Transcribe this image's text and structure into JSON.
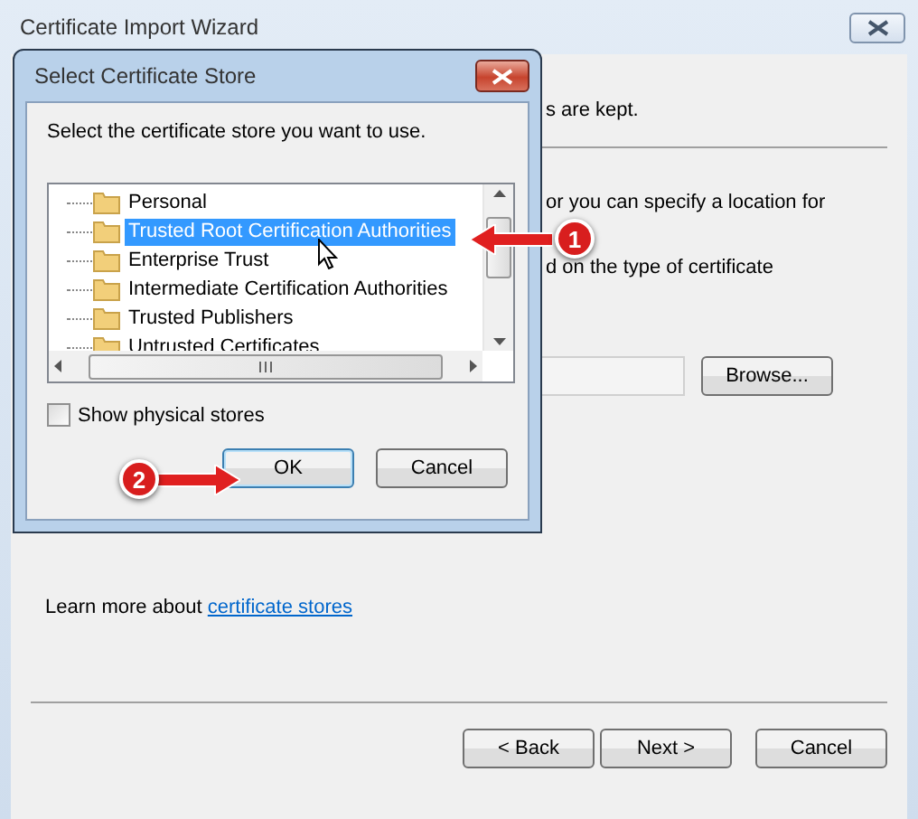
{
  "window": {
    "title": "Certificate Import Wizard"
  },
  "wizard": {
    "fragments": [
      "s are kept.",
      "or you can specify a location for",
      "d on the type of certificate"
    ],
    "browse_button": "Browse...",
    "learn_more": {
      "text": "Learn more about",
      "link": "certificate stores"
    },
    "buttons": [
      {
        "label": "< Back"
      },
      {
        "label": "Next >"
      },
      {
        "label": "Cancel"
      }
    ]
  },
  "dialog": {
    "title": "Select Certificate Store",
    "prompt": "Select the certificate store you want to use.",
    "stores": [
      {
        "label": "Personal",
        "selected": false
      },
      {
        "label": "Trusted Root Certification Authorities",
        "selected": true
      },
      {
        "label": "Enterprise Trust",
        "selected": false
      },
      {
        "label": "Intermediate Certification Authorities",
        "selected": false
      },
      {
        "label": "Trusted Publishers",
        "selected": false
      },
      {
        "label": "Untrusted Certificates",
        "selected": false
      }
    ],
    "show_physical_stores": {
      "label": "Show physical stores",
      "checked": false
    },
    "buttons": [
      {
        "label": "OK",
        "default": true
      },
      {
        "label": "Cancel",
        "default": false
      }
    ]
  },
  "annotations": [
    {
      "number": "1"
    },
    {
      "number": "2"
    }
  ]
}
